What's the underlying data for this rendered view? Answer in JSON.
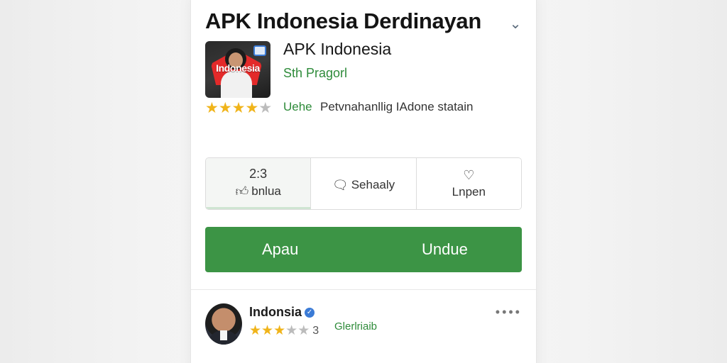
{
  "header": {
    "title": "APK Indonesia Derdinayan",
    "collapse_icon": "chevron-down-icon"
  },
  "app": {
    "icon_text": "Indonesia",
    "name": "APK Indonesia",
    "developer": "Sth Pragorl",
    "rating": 4,
    "rating_max": 5,
    "tag": "Uehe",
    "description": "Petvnahanllig IAdone statain"
  },
  "stats": [
    {
      "top": "2:3",
      "icon": "thumbs-up-icon",
      "label": "bnlua",
      "active": true
    },
    {
      "top": "",
      "icon": "speech-bubble-icon",
      "label": "Sehaaly",
      "active": false
    },
    {
      "top": "",
      "icon": "heart-icon",
      "label": "Lnpen",
      "active": false
    }
  ],
  "cta": {
    "left_label": "Apau",
    "right_label": "Undue",
    "color": "#3c9445"
  },
  "review": {
    "reviewer": "Indonsia",
    "verified": true,
    "rating": 3.5,
    "count": "3",
    "tag": "Glerlriaib",
    "more_icon": "more-dots-icon"
  },
  "colors": {
    "accent_green": "#2e8b3a",
    "star": "#f0b41a"
  }
}
